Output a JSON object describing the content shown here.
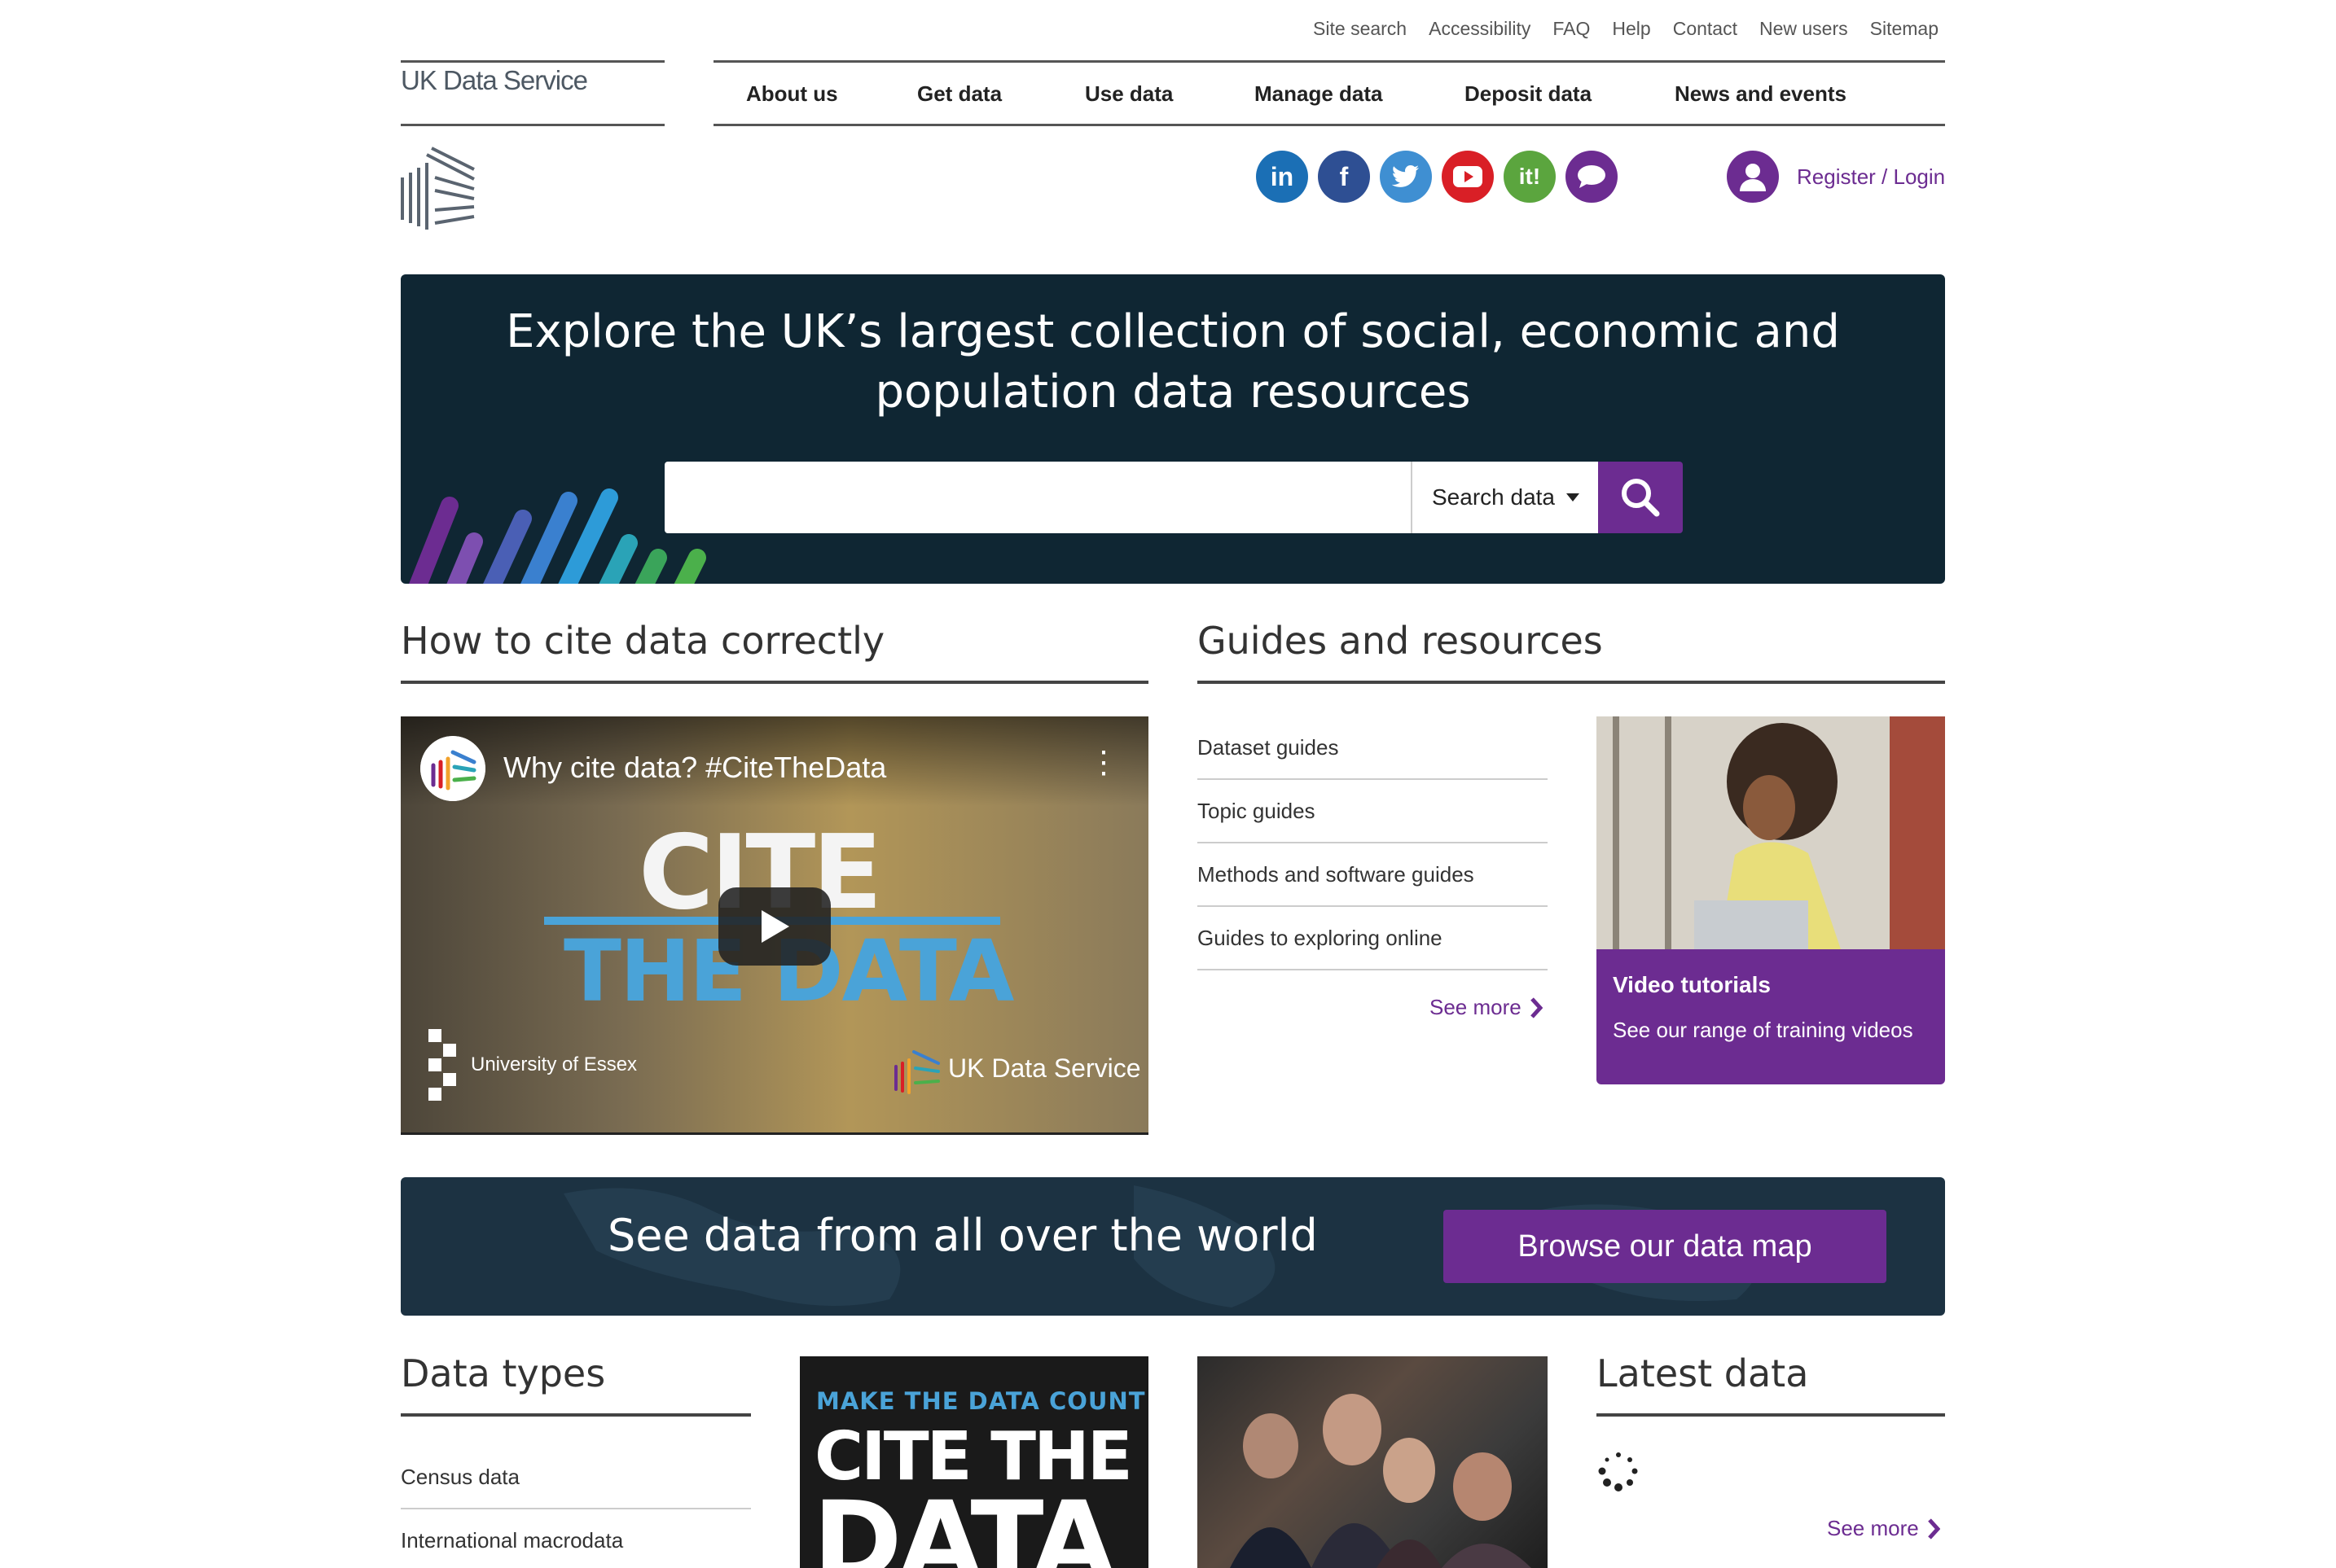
{
  "utility_links": [
    "Site search",
    "Accessibility",
    "FAQ",
    "Help",
    "Contact",
    "New users",
    "Sitemap"
  ],
  "logo": {
    "text": "UK Data Service"
  },
  "nav": {
    "items": [
      "About us",
      "Get data",
      "Use data",
      "Manage data",
      "Deposit data",
      "News and events"
    ]
  },
  "social": [
    {
      "name": "linkedin",
      "glyph": "in",
      "color": "#1b6fb5"
    },
    {
      "name": "facebook",
      "glyph": "f",
      "color": "#2e4f93"
    },
    {
      "name": "twitter",
      "glyph": "t",
      "color": "#3f8fd2"
    },
    {
      "name": "youtube",
      "glyph": "▶",
      "color": "#d91f26"
    },
    {
      "name": "iti",
      "glyph": "it!",
      "color": "#5ba53e"
    },
    {
      "name": "chat",
      "glyph": "…",
      "color": "#6c2c91"
    }
  ],
  "account": {
    "label": "Register / Login"
  },
  "hero": {
    "title_line1": "Explore the UK’s largest collection of social, economic and",
    "title_line2": "population data resources",
    "search_placeholder": "",
    "search_select": "Search data"
  },
  "cite_section": {
    "title": "How to cite data correctly",
    "video": {
      "title": "Why cite data? #CiteTheData",
      "big_text_1": "CITE",
      "big_text_2": "THE DATA",
      "partner_1": "University of Essex",
      "partner_2": "UK Data Service"
    }
  },
  "guides_section": {
    "title": "Guides and resources",
    "items": [
      "Dataset guides",
      "Topic guides",
      "Methods and software guides",
      "Guides to exploring online"
    ],
    "see_more": "See more",
    "card": {
      "title": "Video tutorials",
      "text": "See our range of training videos"
    }
  },
  "world_banner": {
    "title": "See data from all over the world",
    "button": "Browse our data map"
  },
  "data_types": {
    "title": "Data types",
    "items": [
      "Census data",
      "International macrodata"
    ]
  },
  "poster": {
    "line1": "MAKE THE DATA COUNT",
    "line2": "CITE THE",
    "line3": "DATA"
  },
  "latest_data": {
    "title": "Latest data",
    "see_more": "See more"
  },
  "colors": {
    "accent": "#6c2c91",
    "hero_bg": "#0f2633",
    "banner_bg": "#1c3242"
  }
}
